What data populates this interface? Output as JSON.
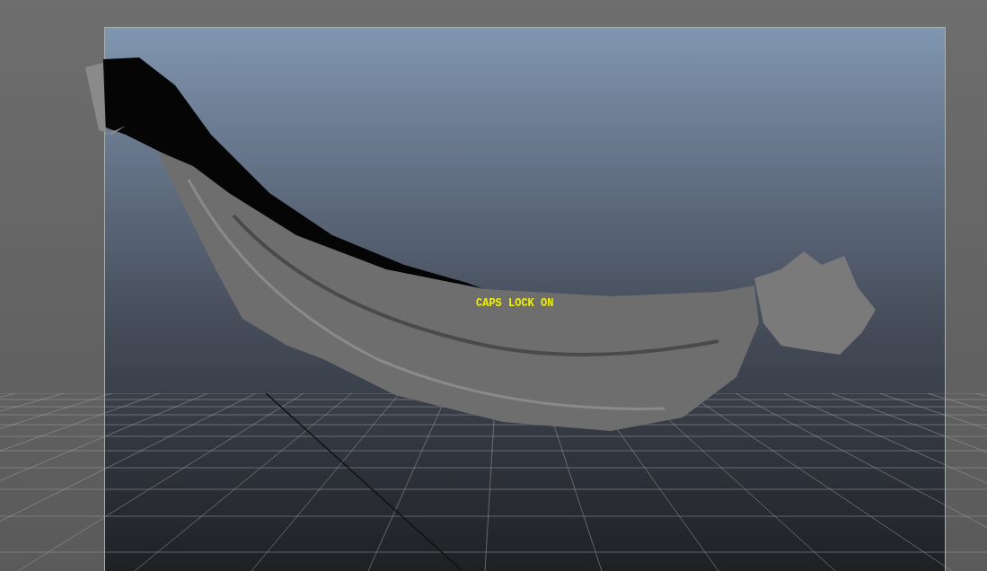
{
  "viewport": {
    "message": "CAPS LOCK ON"
  }
}
